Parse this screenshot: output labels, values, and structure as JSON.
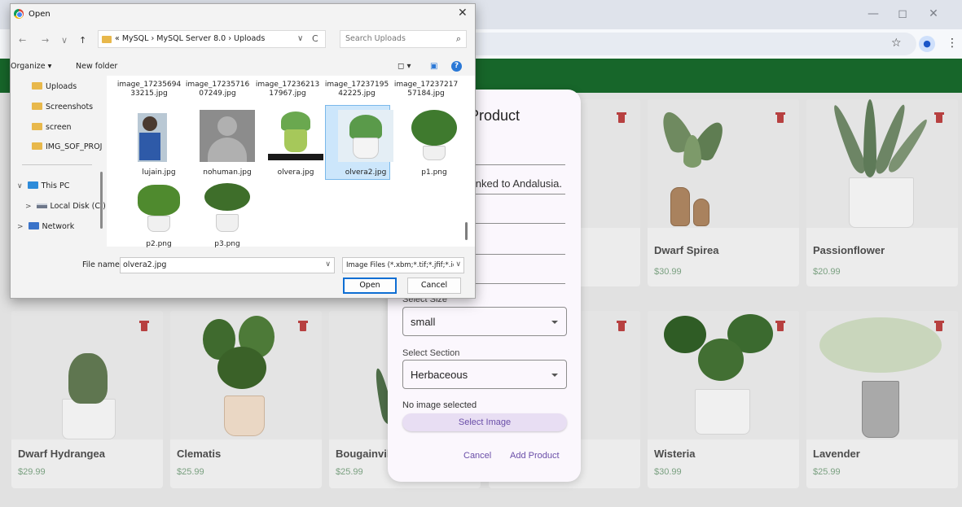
{
  "browser": {
    "minimize_glyph": "—",
    "restore_glyph": "◻",
    "close_glyph": "✕",
    "bookmark_glyph": "☆",
    "profile_glyph": "●",
    "menu_glyph": "⋮"
  },
  "cards": [
    {
      "name": "Dwarf Spirea",
      "price": "$30.99"
    },
    {
      "name": "Passionflower",
      "price": "$20.99"
    },
    {
      "name": "Dwarf Hydrangea",
      "price": "$29.99"
    },
    {
      "name": "Clematis",
      "price": "$25.99"
    },
    {
      "name": "Bougainvill",
      "price": "$25.99"
    },
    {
      "name": "Wisteria",
      "price": "$30.99"
    },
    {
      "name": "Lavender",
      "price": "$25.99"
    }
  ],
  "modal": {
    "title": "Product",
    "description_partial": "linked to Andalusia.",
    "size_label": "Select Size",
    "size_value": "small",
    "section_label": "Select Section",
    "section_value": "Herbaceous",
    "no_image_text": "No image selected",
    "select_image_label": "Select Image",
    "cancel_label": "Cancel",
    "add_label": "Add Product"
  },
  "dialog": {
    "title": "Open",
    "close_glyph": "✕",
    "nav": {
      "back": "←",
      "forward": "→",
      "recent": "∨",
      "up": "↑"
    },
    "path": "« MySQL › MySQL Server 8.0 › Uploads",
    "path_dropdown": "∨",
    "refresh": "C",
    "search_placeholder": "Search Uploads",
    "search_glyph": "⌕",
    "organize": "Organize ▾",
    "new_folder": "New folder",
    "view_glyph_1": "◻ ▾",
    "view_glyph_2": "▣",
    "help_glyph": "?",
    "sidebar": {
      "quick_items": [
        "Uploads",
        "Screenshots",
        "screen",
        "IMG_SOF_PROJ"
      ],
      "this_pc": "This PC",
      "local_disk": "Local Disk (C:)",
      "network": "Network",
      "expand_open": "∨",
      "expand_closed": ">"
    },
    "top_row_files": [
      "image_1723569433215.jpg",
      "image_1723571607249.jpg",
      "image_1723621317967.jpg",
      "image_1723719542225.jpg",
      "image_1723721757184.jpg"
    ],
    "top_row_lines": [
      [
        "image_17235694",
        "33215.jpg"
      ],
      [
        "image_17235716",
        "07249.jpg"
      ],
      [
        "image_17236213",
        "17967.jpg"
      ],
      [
        "image_17237195",
        "42225.jpg"
      ],
      [
        "image_17237217",
        "57184.jpg"
      ]
    ],
    "files": [
      "lujain.jpg",
      "nohuman.jpg",
      "olvera.jpg",
      "olvera2.jpg",
      "p1.png",
      "p2.png",
      "p3.png"
    ],
    "selected_file": "olvera2.jpg",
    "filename_label": "File name:",
    "filename_value": "olvera2.jpg",
    "filetype_value": "Image Files (*.xbm;*.tif;*.jfif;*.icc",
    "dropdown_glyph": "∨",
    "open_label": "Open",
    "cancel_label": "Cancel"
  }
}
